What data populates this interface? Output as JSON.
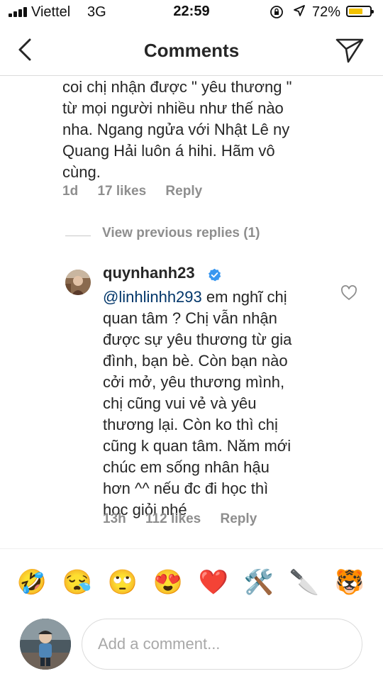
{
  "status_bar": {
    "carrier": "Viettel",
    "network": "3G",
    "time": "22:59",
    "battery": "72%",
    "battery_level": 0.72
  },
  "header": {
    "title": "Comments",
    "back_icon": "chevron-left-icon",
    "send_icon": "paper-plane-icon"
  },
  "comment_top": {
    "text_lines": [
      "coi chị nhận được \" yêu thương \"",
      "từ mọi người nhiều như thế nào",
      "nha. Ngang ngửa với Nhật Lê ny",
      "Quang Hải luôn á hihi. Hãm vô",
      "cùng."
    ],
    "time": "1d",
    "likes": "17 likes",
    "reply": "Reply"
  },
  "view_previous_replies": "View previous replies (1)",
  "reply_comment": {
    "username": "quynhanh23",
    "verified": true,
    "mention": "@linhlinhh293",
    "text_lines": [
      " em nghĩ chị",
      "quan tâm ? Chị vẫn nhận",
      "được sự yêu thương từ gia",
      "đình, bạn bè. Còn bạn nào",
      "cởi mở, yêu thương mình,",
      "chị cũng vui vẻ và yêu",
      "thương lại. Còn ko thì chị",
      "cũng k quan tâm. Năm mới",
      "chúc em sống nhân hậu",
      "hơn ^^ nếu đc đi học thì",
      "học giỏi nhé"
    ],
    "time": "13h",
    "likes": "112 likes",
    "reply": "Reply"
  },
  "emoji_bar": {
    "emojis": [
      {
        "char": "🤣",
        "name": "rolling-laughing-emoji"
      },
      {
        "char": "😪",
        "name": "sleepy-face-emoji"
      },
      {
        "char": "🙄",
        "name": "eye-roll-emoji"
      },
      {
        "char": "😍",
        "name": "heart-eyes-emoji"
      },
      {
        "char": "❤️",
        "name": "red-heart-emoji"
      },
      {
        "char": "🛠️",
        "name": "tools-emoji"
      },
      {
        "char": "🔪",
        "name": "knife-emoji"
      },
      {
        "char": "🐯",
        "name": "tiger-face-emoji"
      }
    ]
  },
  "composer": {
    "placeholder": "Add a comment..."
  },
  "colors": {
    "mention": "#003569",
    "meta_gray": "#8e8e8e",
    "verified_blue": "#3897f0",
    "battery_yellow": "#f2c200"
  }
}
